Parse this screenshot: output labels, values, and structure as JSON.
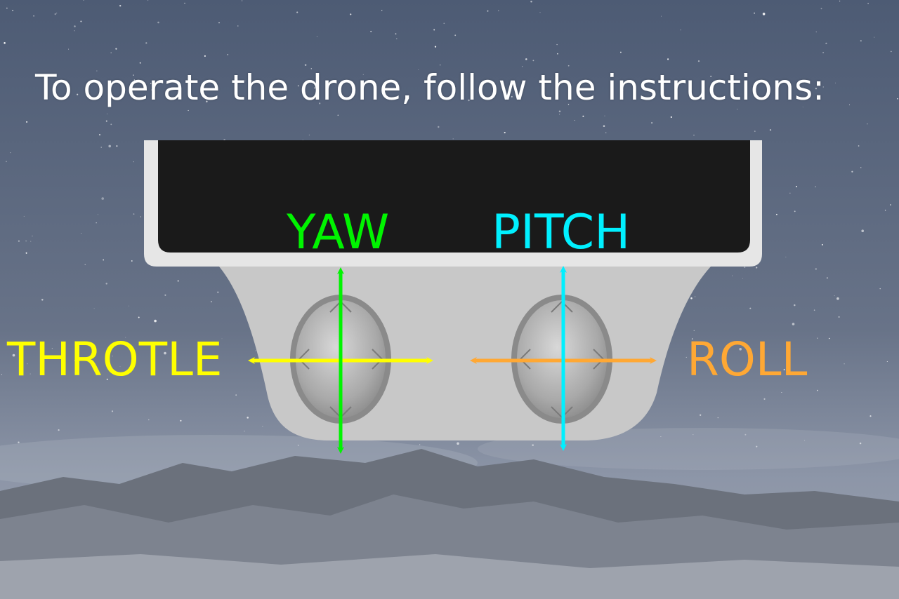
{
  "instructions": {
    "text": "To operate the drone, follow the instructions:"
  },
  "controls": {
    "yaw": {
      "label": "YAW",
      "color": "#00f400"
    },
    "pitch": {
      "label": "PITCH",
      "color": "#00f0ff"
    },
    "throttle": {
      "label": "THROTLE",
      "color": "#ffff00"
    },
    "roll": {
      "label": "ROLL",
      "color": "#ffa834"
    }
  },
  "colors": {
    "sky_top": "#4d5b74",
    "sky_bottom": "#8d96a8",
    "controller_body": "#c8c8c8",
    "controller_frame": "#e6e6e6",
    "screen": "#1a1a1a",
    "stick": "#a8a8a8"
  },
  "icons": [
    "drone-controller-icon",
    "joystick-icon",
    "arrow-icon"
  ]
}
